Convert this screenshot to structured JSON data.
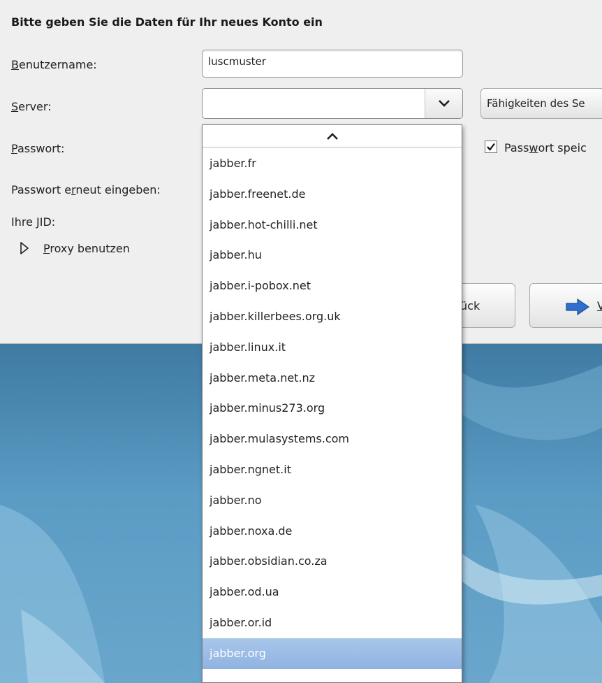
{
  "dialog": {
    "heading": "Bitte geben Sie die Daten für Ihr neues Konto ein",
    "username": {
      "label_mnemonic": "B",
      "label_rest": "enutzername:",
      "value": "luscmuster"
    },
    "server": {
      "label_mnemonic": "S",
      "label_rest": "erver:",
      "value": "",
      "capabilities_button": "Fähigkeiten des Se"
    },
    "password": {
      "label_mnemonic": "P",
      "label_rest": "asswort:",
      "save_prefix": "Pass",
      "save_mnemonic": "w",
      "save_rest": "ort speic",
      "save_checked": true
    },
    "password_repeat": {
      "label_prefix": "Passwort e",
      "label_mnemonic": "r",
      "label_rest": "neut eingeben:"
    },
    "jid": {
      "label": "Ihre JID:"
    },
    "proxy": {
      "label_mnemonic": "P",
      "label_rest": "roxy benutzen"
    },
    "back_button_partial": "ück",
    "next_button_partial": "V"
  },
  "server_list": {
    "items": [
      "jabber.fr",
      "jabber.freenet.de",
      "jabber.hot-chilli.net",
      "jabber.hu",
      "jabber.i-pobox.net",
      "jabber.killerbees.org.uk",
      "jabber.linux.it",
      "jabber.meta.net.nz",
      "jabber.minus273.org",
      "jabber.mulasystems.com",
      "jabber.ngnet.it",
      "jabber.no",
      "jabber.noxa.de",
      "jabber.obsidian.co.za",
      "jabber.od.ua",
      "jabber.or.id",
      "jabber.org"
    ],
    "selected": "jabber.org"
  },
  "colors": {
    "dialog_bg": "#efefef",
    "selection": "#9ab9e4",
    "desktop": "#4f8db5",
    "next_arrow": "#2f6fd0"
  },
  "icons": {
    "combo_arrow": "chevron-down-icon",
    "scroll_up": "chevron-up-icon",
    "proxy_expander": "triangle-right-icon",
    "next": "arrow-right-icon",
    "checkbox": "checkmark-icon"
  }
}
